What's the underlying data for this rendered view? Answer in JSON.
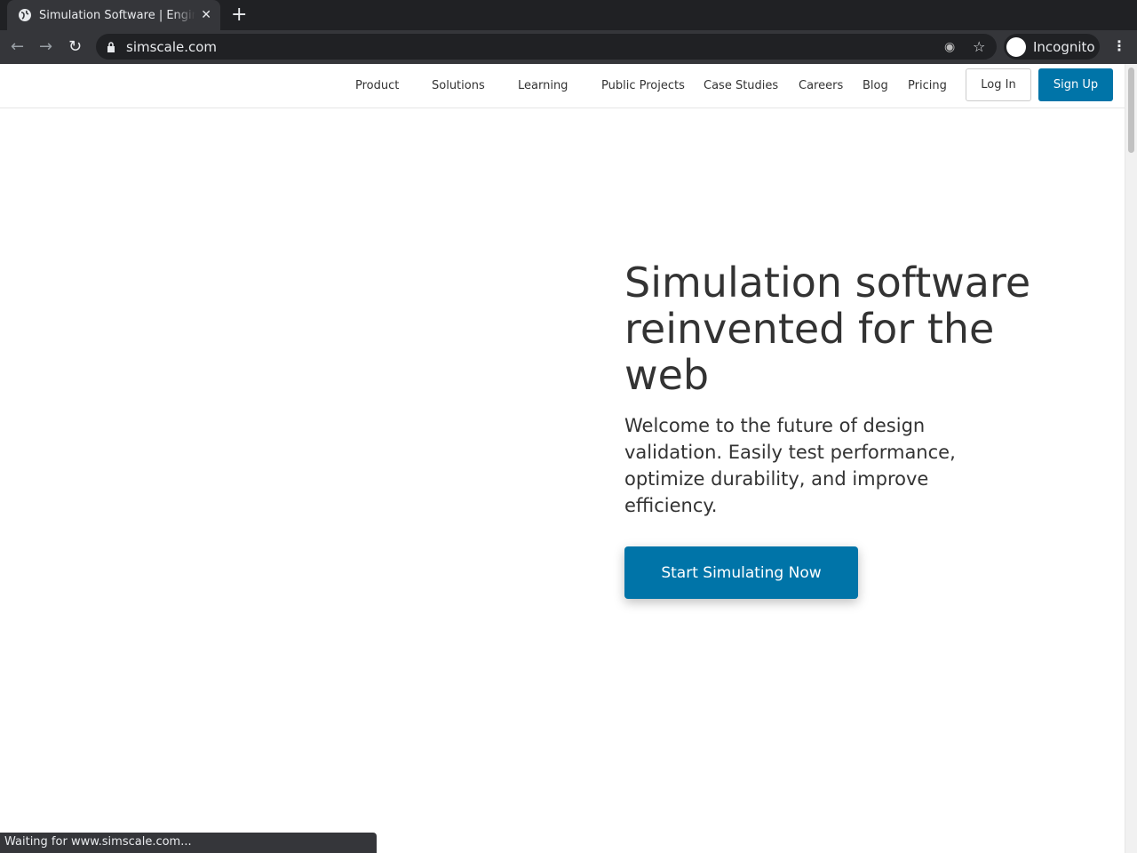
{
  "browser": {
    "tab_title": "Simulation Software | Engineering in the Cloud",
    "url": "simscale.com",
    "profile_label": "Incognito",
    "status_text": "Waiting for www.simscale.com..."
  },
  "nav": {
    "items": [
      "Product",
      "Solutions",
      "Learning",
      "Public Projects",
      "Case Studies",
      "Careers",
      "Blog",
      "Pricing"
    ],
    "login": "Log In",
    "signup": "Sign Up"
  },
  "hero": {
    "title": "Simulation software reinvented for the web",
    "subtitle": "Welcome to the future of design validation. Easily test performance, optimize durability, and improve efficiency.",
    "cta": "Start Simulating Now"
  },
  "colors": {
    "accent": "#0074a8"
  }
}
